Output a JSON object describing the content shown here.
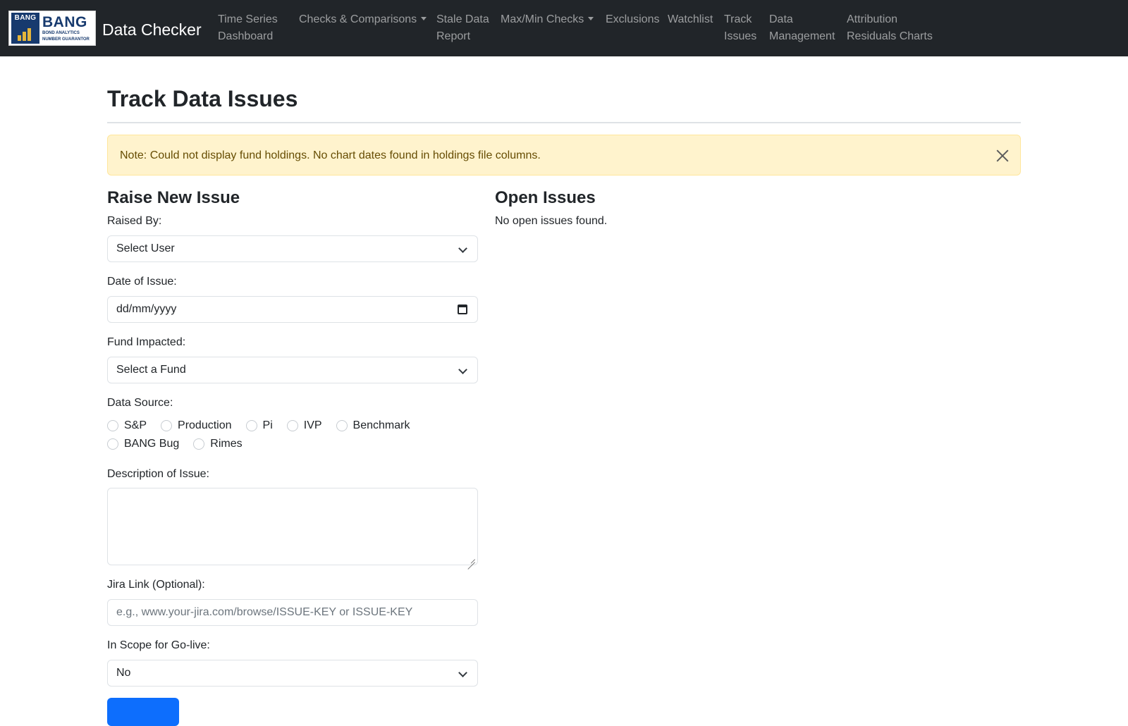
{
  "navbar": {
    "logo": {
      "badge_text": "BANG",
      "wordmark": "BANG",
      "subtitle_line1": "BOND ANALYTICS",
      "subtitle_line2": "NUMBER GUARANTOR",
      "colors": {
        "navy": "#173a6e",
        "gold": "#e5b53a"
      }
    },
    "brand": "Data Checker",
    "items": [
      {
        "line1": "Time Series",
        "line2": "Dashboard"
      },
      {
        "line1": "Checks & Comparisons",
        "dropdown": true
      },
      {
        "line1": "Stale Data",
        "line2": "Report"
      },
      {
        "line1": "Max/Min Checks",
        "dropdown": true
      },
      {
        "line1": "Exclusions"
      },
      {
        "line1": "Watchlist"
      },
      {
        "line1": "Track",
        "line2": "Issues"
      },
      {
        "line1": "Data",
        "line2": "Management"
      },
      {
        "line1": "Attribution",
        "line2": "Residuals Charts"
      }
    ]
  },
  "page": {
    "title": "Track Data Issues"
  },
  "alert": {
    "text": "Note: Could not display fund holdings. No chart dates found in holdings file columns.",
    "close_icon": "close-icon"
  },
  "form": {
    "heading": "Raise New Issue",
    "raised_by": {
      "label": "Raised By:",
      "value": "Select User"
    },
    "date_of_issue": {
      "label": "Date of Issue:",
      "placeholder": "dd/mm/yyyy"
    },
    "fund_impacted": {
      "label": "Fund Impacted:",
      "value": "Select a Fund"
    },
    "data_source": {
      "label": "Data Source:",
      "options": [
        "S&P",
        "Production",
        "Pi",
        "IVP",
        "Benchmark",
        "BANG Bug",
        "Rimes"
      ]
    },
    "description": {
      "label": "Description of Issue:",
      "value": ""
    },
    "jira_link": {
      "label": "Jira Link (Optional):",
      "placeholder": "e.g., www.your-jira.com/browse/ISSUE-KEY or ISSUE-KEY"
    },
    "in_scope": {
      "label": "In Scope for Go-live:",
      "value": "No"
    }
  },
  "open_issues": {
    "heading": "Open Issues",
    "empty_text": "No open issues found."
  },
  "colors": {
    "navbar_bg": "#212529",
    "alert_bg": "#fff3cd",
    "alert_text": "#664d03",
    "primary": "#0d6efd"
  }
}
